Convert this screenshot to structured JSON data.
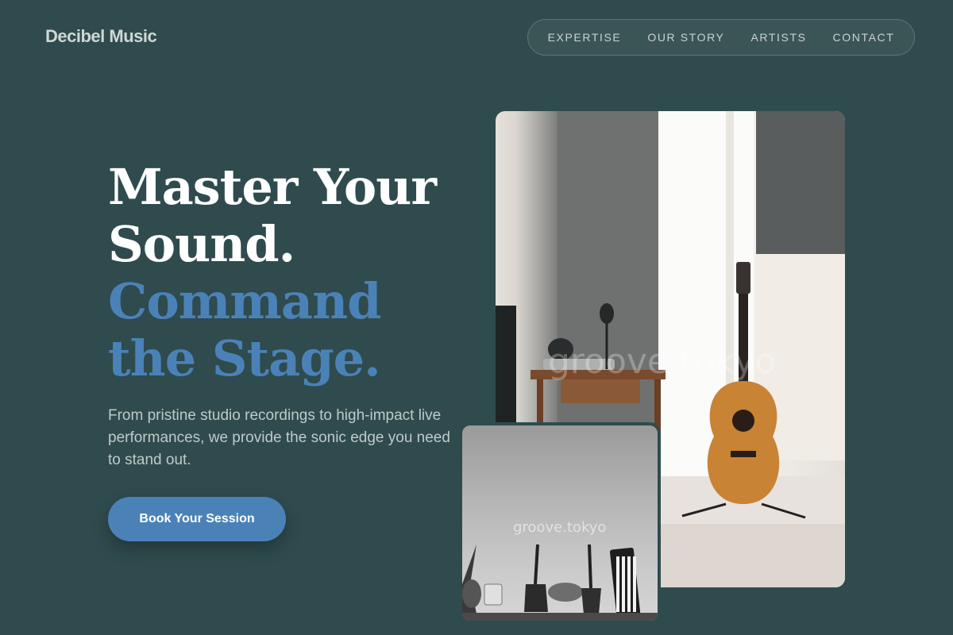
{
  "brand": "Decibel Music",
  "nav": [
    "EXPERTISE",
    "OUR STORY",
    "ARTISTS",
    "CONTACT"
  ],
  "hero": {
    "line1": "Master Your",
    "line2": "Sound.",
    "line3": "Command",
    "line4": "the Stage.",
    "subtext": "From pristine studio recordings to high-impact live performances, we provide the sonic edge you need to stand out.",
    "cta": "Book Your Session"
  },
  "images": {
    "main_watermark": "groove.tokyo",
    "small_watermark": "groove.tokyo"
  },
  "colors": {
    "background": "#2f4b4d",
    "accent": "#4a82b8"
  }
}
